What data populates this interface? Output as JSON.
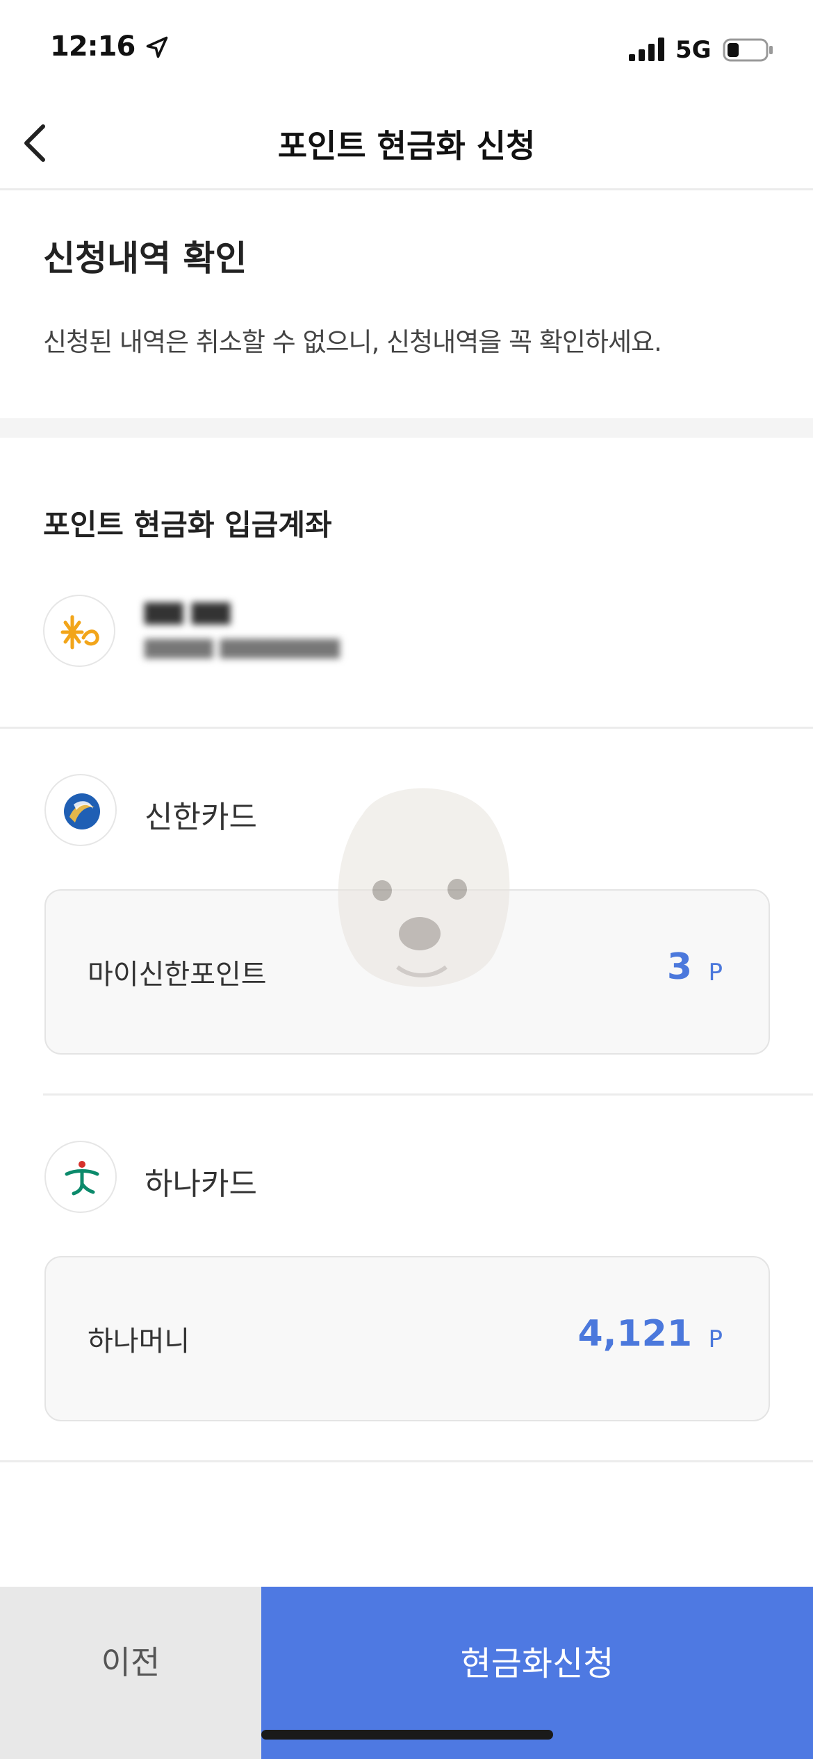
{
  "status_bar": {
    "time": "12:16",
    "network": "5G",
    "icons": [
      "location-arrow-icon",
      "signal-bars-icon",
      "battery-icon"
    ]
  },
  "header": {
    "title": "포인트 현금화 신청",
    "back_icon": "chevron-left-icon"
  },
  "confirm": {
    "title": "신청내역 확인",
    "description": "신청된 내역은 취소할 수 없으니, 신청내역을 꼭 확인하세요."
  },
  "account": {
    "title": "포인트 현금화 입금계좌",
    "bank_name_masked": "▆▆ ▆▆",
    "account_number_masked": "▆▆▆▆ ▆▆▆▆▆▆▆"
  },
  "cards": [
    {
      "name": "신한카드",
      "point_label": "마이신한포인트",
      "point_value": "3",
      "unit": "P",
      "logo": "shinhan-logo-icon"
    },
    {
      "name": "하나카드",
      "point_label": "하나머니",
      "point_value": "4,121",
      "unit": "P",
      "logo": "hana-logo-icon"
    }
  ],
  "buttons": {
    "prev": "이전",
    "apply": "현금화신청"
  },
  "colors": {
    "accent": "#4e79e2",
    "point_value": "#4b78dc",
    "prev_button_bg": "#e8e8e8"
  }
}
